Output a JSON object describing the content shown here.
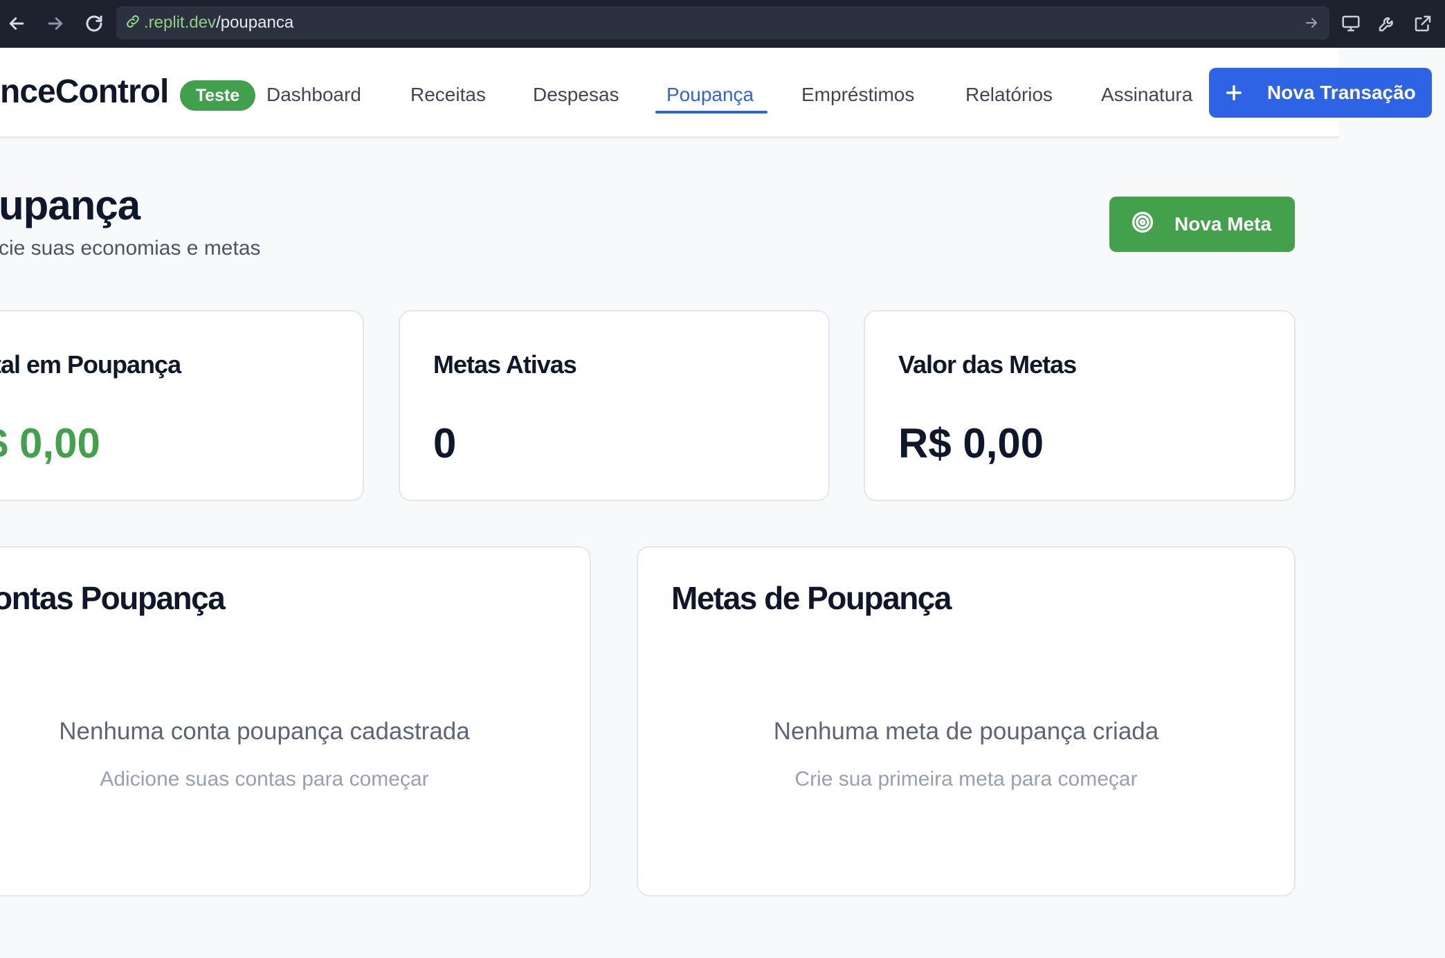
{
  "browser": {
    "url_host": ".replit.dev",
    "url_path": "/poupanca",
    "icons": [
      "back-icon",
      "forward-icon",
      "reload-icon",
      "link-icon",
      "go-arrow-icon",
      "monitor-icon",
      "wrench-icon",
      "external-link-icon"
    ]
  },
  "header": {
    "brand": "nceControl",
    "badge": "Teste",
    "nav": [
      "Dashboard",
      "Receitas",
      "Despesas",
      "Poupança",
      "Empréstimos",
      "Relatórios",
      "Assinatura"
    ],
    "active_nav": "Poupança",
    "new_transaction_label": "Nova Transação",
    "accent_color": "#2f63e6"
  },
  "page": {
    "title": "upança",
    "subtitle": "cie suas economias e metas",
    "new_goal_label": "Nova Meta",
    "new_goal_color": "#43a04b"
  },
  "stats": [
    {
      "label": "tal em Poupança",
      "value": "$ 0,00",
      "color": "#43a04b"
    },
    {
      "label": "Metas Ativas",
      "value": "0"
    },
    {
      "label": "Valor das Metas",
      "value": "R$ 0,00"
    }
  ],
  "panels": {
    "accounts": {
      "title": "ontas Poupança",
      "empty_title": "Nenhuma conta poupança cadastrada",
      "empty_subtitle": "Adicione suas contas para começar"
    },
    "goals": {
      "title": "Metas de Poupança",
      "empty_title": "Nenhuma meta de poupança criada",
      "empty_subtitle": "Crie sua primeira meta para começar"
    }
  }
}
